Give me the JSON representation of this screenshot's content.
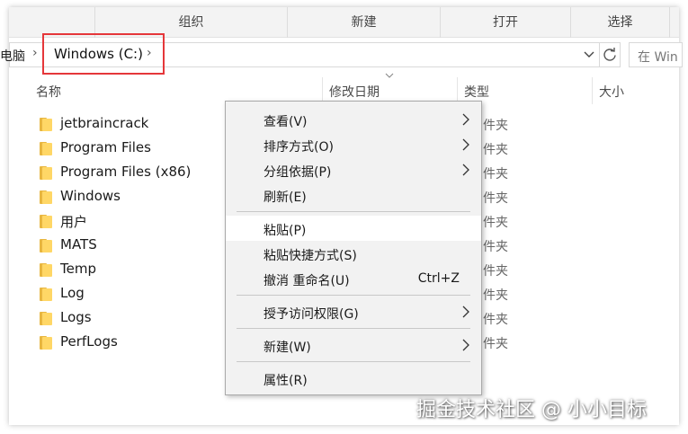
{
  "ribbon": {
    "groups": [
      "组织",
      "新建",
      "打开",
      "选择"
    ]
  },
  "address": {
    "previous_crumb": "电脑",
    "current_crumb": "Windows (C:)",
    "search_placeholder": "在 Win"
  },
  "columns": {
    "name": "名称",
    "modified": "修改日期",
    "type": "类型",
    "size": "大小"
  },
  "files": [
    {
      "name": "jetbraincrack",
      "type": "件夹"
    },
    {
      "name": "Program Files",
      "type": "件夹"
    },
    {
      "name": "Program Files (x86)",
      "type": "件夹"
    },
    {
      "name": "Windows",
      "type": "件夹"
    },
    {
      "name": "用户",
      "type": "件夹"
    },
    {
      "name": "MATS",
      "type": "件夹"
    },
    {
      "name": "Temp",
      "type": "件夹"
    },
    {
      "name": "Log",
      "type": "件夹"
    },
    {
      "name": "Logs",
      "type": "件夹"
    },
    {
      "name": "PerfLogs",
      "type": "件夹"
    }
  ],
  "context_menu": {
    "view": "查看(V)",
    "sort_by": "排序方式(O)",
    "group_by": "分组依据(P)",
    "refresh": "刷新(E)",
    "paste": "粘贴(P)",
    "paste_shortcut": "粘贴快捷方式(S)",
    "undo_rename": "撤消 重命名(U)",
    "undo_shortcut": "Ctrl+Z",
    "grant_access": "授予访问权限(G)",
    "new": "新建(W)",
    "properties": "属性(R)"
  },
  "watermark": "掘金技术社区 @ 小小目标",
  "colors": {
    "highlight_border": "#e5373a",
    "folder_front": "#ffd766",
    "folder_back": "#e8b640",
    "menu_background": "#f2f2f2"
  }
}
